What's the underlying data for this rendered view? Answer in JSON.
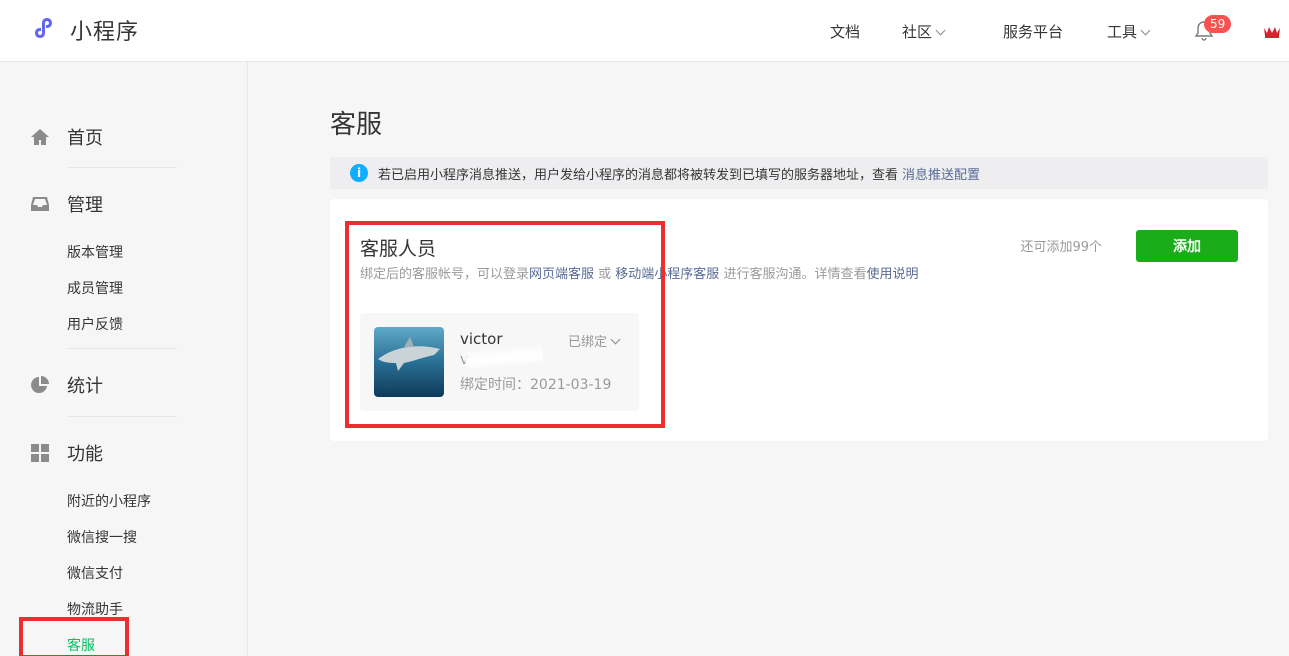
{
  "header": {
    "logo_text": "小程序",
    "nav": [
      {
        "label": "文档",
        "dropdown": false
      },
      {
        "label": "社区",
        "dropdown": true
      },
      {
        "label": "服务平台",
        "dropdown": false
      },
      {
        "label": "工具",
        "dropdown": true
      }
    ],
    "notification_count": "59",
    "icons": {
      "logo": "link-logo-icon",
      "bell": "bell-icon",
      "avatar": "crown-avatar-icon"
    },
    "brand_color": "#6467f0"
  },
  "sidebar": {
    "sections": [
      {
        "label": "首页",
        "icon": "home-icon"
      },
      {
        "label": "管理",
        "icon": "inbox-icon",
        "items": [
          "版本管理",
          "成员管理",
          "用户反馈"
        ]
      },
      {
        "label": "统计",
        "icon": "pie-chart-icon"
      },
      {
        "label": "功能",
        "icon": "grid-icon",
        "items": [
          "附近的小程序",
          "微信搜一搜",
          "微信支付",
          "物流助手",
          "客服"
        ]
      }
    ],
    "active_item": "客服",
    "active_color": "#07c160"
  },
  "main": {
    "title": "客服",
    "notice": {
      "icon": "info-icon",
      "text": "若已启用小程序消息推送，用户发给小程序的消息都将被转发到已填写的服务器地址，查看",
      "link": "消息推送配置"
    },
    "card": {
      "title": "客服人员",
      "desc_1": "绑定后的客服帐号，可以登录",
      "link_web": "网页端客服",
      "desc_2": " 或 ",
      "link_mobile": "移动端小程序客服",
      "desc_3": " 进行客服沟通。详情查看",
      "link_help": "使用说明",
      "remaining": "还可添加99个",
      "add_button": "添加",
      "add_button_color": "#1aad19",
      "members": [
        {
          "name": "victor",
          "id": "v...",
          "bind_time": "绑定时间：2021-03-19",
          "status": "已绑定",
          "avatar": "shark-photo"
        }
      ]
    }
  },
  "highlight_color": "#ee2e2e"
}
